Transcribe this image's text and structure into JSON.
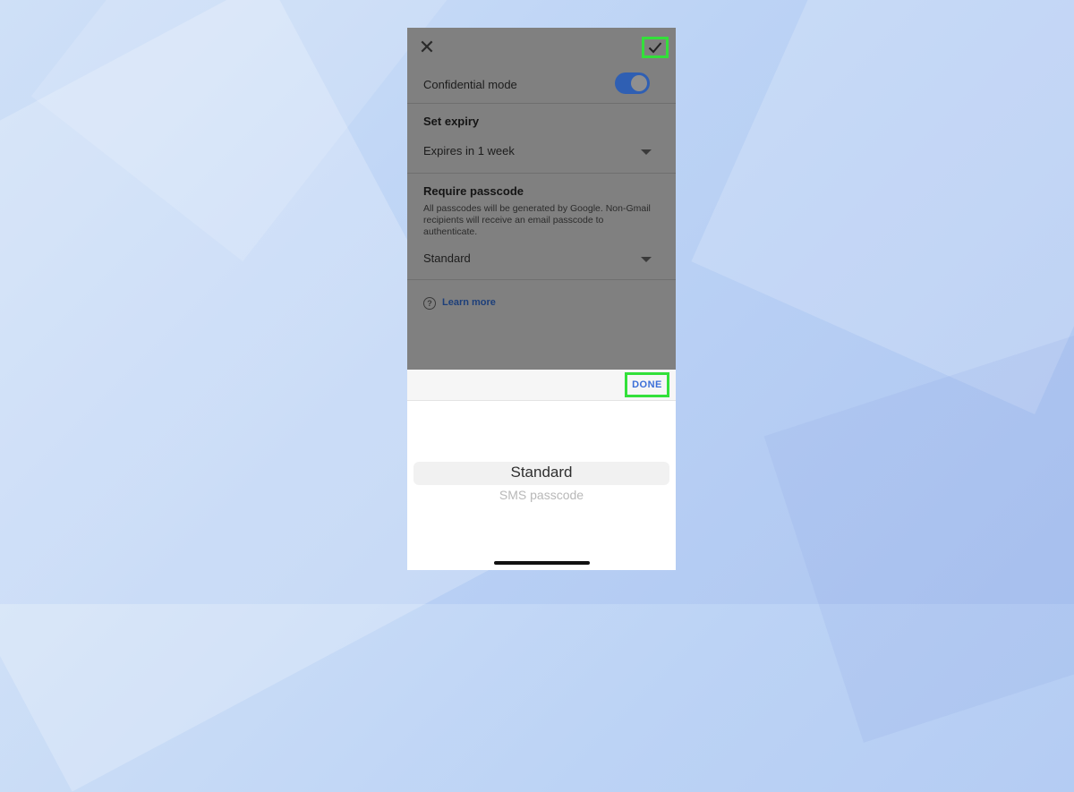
{
  "colors": {
    "highlight_box": "#33e03a",
    "toggle_on": "#2f5fb3",
    "done_text": "#3b6fd8",
    "link": "#1d3f7a"
  },
  "header": {
    "close_icon": "close-icon",
    "confirm_icon": "checkmark-icon"
  },
  "confidential": {
    "label": "Confidential mode",
    "enabled": true
  },
  "expiry": {
    "title": "Set expiry",
    "selected": "Expires in 1 week"
  },
  "passcode": {
    "title": "Require passcode",
    "description": "All passcodes will be generated by Google. Non-Gmail recipients will receive an email passcode to authenticate.",
    "selected": "Standard"
  },
  "learn_more": {
    "label": "Learn more",
    "icon": "help-circle-icon"
  },
  "picker": {
    "done_label": "DONE",
    "options": [
      "Standard",
      "SMS passcode"
    ],
    "selected_index": 0
  }
}
